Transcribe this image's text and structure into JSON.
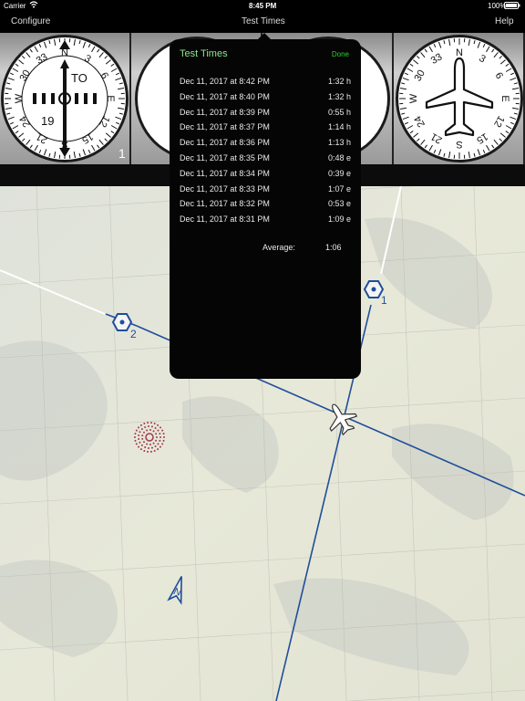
{
  "status_bar": {
    "carrier": "Carrier",
    "time": "8:45 PM",
    "battery": "100%"
  },
  "nav": {
    "configure": "Configure",
    "title": "Test Times",
    "help": "Help"
  },
  "instruments": {
    "obs": {
      "to_from": "TO",
      "course": "19",
      "number": "1",
      "ticks": [
        "N",
        "3",
        "6",
        "E",
        "12",
        "15",
        "S",
        "21",
        "24",
        "W",
        "30",
        "33"
      ]
    },
    "heading": {
      "ticks": [
        "N",
        "3",
        "6",
        "E",
        "12",
        "15",
        "S",
        "21",
        "24",
        "W",
        "30",
        "33"
      ]
    }
  },
  "popover": {
    "title": "Test Times",
    "done": "Done",
    "rows": [
      {
        "date": "Dec 11, 2017 at 8:42 PM",
        "time": "1:32 h"
      },
      {
        "date": "Dec 11, 2017 at 8:40 PM",
        "time": "1:32 h"
      },
      {
        "date": "Dec 11, 2017 at 8:39 PM",
        "time": "0:55 h"
      },
      {
        "date": "Dec 11, 2017 at 8:37 PM",
        "time": "1:14 h"
      },
      {
        "date": "Dec 11, 2017 at 8:36 PM",
        "time": "1:13 h"
      },
      {
        "date": "Dec 11, 2017 at 8:35 PM",
        "time": "0:48 e"
      },
      {
        "date": "Dec 11, 2017 at 8:34 PM",
        "time": "0:39 e"
      },
      {
        "date": "Dec 11, 2017 at 8:33 PM",
        "time": "1:07 e"
      },
      {
        "date": "Dec 11, 2017 at 8:32 PM",
        "time": "0:53 e"
      },
      {
        "date": "Dec 11, 2017 at 8:31 PM",
        "time": "1:09 e"
      }
    ],
    "average_label": "Average:",
    "average_value": "1:06"
  },
  "map": {
    "waypoints": [
      {
        "label": "1"
      },
      {
        "label": "2"
      }
    ],
    "north_label": "N",
    "colors": {
      "route": "#1f4e9a",
      "target": "#a23a4a",
      "terrain": "#e4e6da"
    }
  }
}
